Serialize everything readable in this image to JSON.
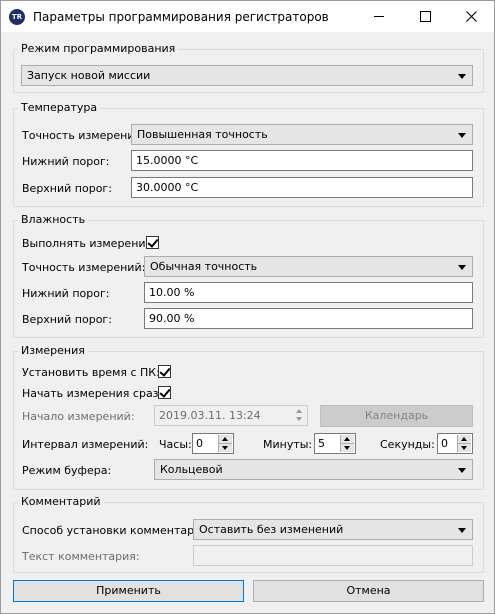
{
  "window": {
    "title": "Параметры программирования регистраторов",
    "app_icon_text": "TR"
  },
  "mode": {
    "legend": "Режим программирования",
    "value": "Запуск новой миссии"
  },
  "temperature": {
    "legend": "Температура",
    "accuracy_label": "Точность измерений:",
    "accuracy_value": "Повышенная точность",
    "low_label": "Нижний порог:",
    "low_value": "15.0000 °C",
    "high_label": "Верхний порог:",
    "high_value": "30.0000 °C"
  },
  "humidity": {
    "legend": "Влажность",
    "measure_label": "Выполнять измерение:",
    "measure_checked": true,
    "accuracy_label": "Точность измерений:",
    "accuracy_value": "Обычная точность",
    "low_label": "Нижний порог:",
    "low_value": "10.00 %",
    "high_label": "Верхний порог:",
    "high_value": "90.00 %"
  },
  "measurements": {
    "legend": "Измерения",
    "set_time_label": "Установить время с ПК:",
    "set_time_checked": true,
    "start_now_label": "Начать измерения сразу:",
    "start_now_checked": true,
    "start_label": "Начало измерений:",
    "start_value": "2019.03.11.  13:24",
    "calendar_label": "Календарь",
    "interval_label": "Интервал измерений:",
    "hours_label": "Часы:",
    "hours_value": "0",
    "minutes_label": "Минуты:",
    "minutes_value": "5",
    "seconds_label": "Секунды:",
    "seconds_value": "0",
    "buffer_label": "Режим буфера:",
    "buffer_value": "Кольцевой"
  },
  "comment": {
    "legend": "Комментарий",
    "method_label": "Способ установки комментария:",
    "method_value": "Оставить без изменений",
    "text_label": "Текст комментария:",
    "text_value": ""
  },
  "footer": {
    "apply_label": "Применить",
    "cancel_label": "Отмена"
  }
}
